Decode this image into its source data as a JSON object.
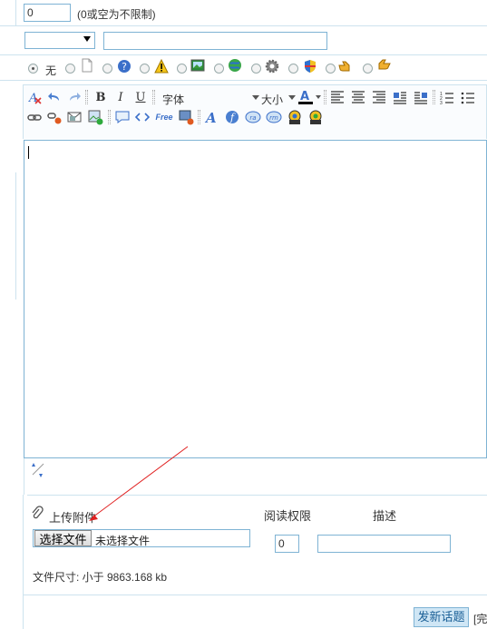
{
  "limit": {
    "value": "0",
    "hint": "(0或空为不限制)"
  },
  "mood": {
    "none_label": "无"
  },
  "toolbar": {
    "font_label": "字体",
    "size_label": "大小",
    "free_label": "Free"
  },
  "attach": {
    "title": "上传附件",
    "read_perm_label": "阅读权限",
    "desc_label": "描述",
    "choose_btn": "选择文件",
    "no_file": "未选择文件",
    "perm_value": "0",
    "size_text": "文件尺寸: 小于 9863.168 kb"
  },
  "footer": {
    "post_btn": "发新话题",
    "extra": "[完"
  },
  "colors": {
    "border": "#7eb3d4",
    "line": "#cde3ee",
    "accent": "#1a5f96",
    "arrow": "#e02020"
  }
}
